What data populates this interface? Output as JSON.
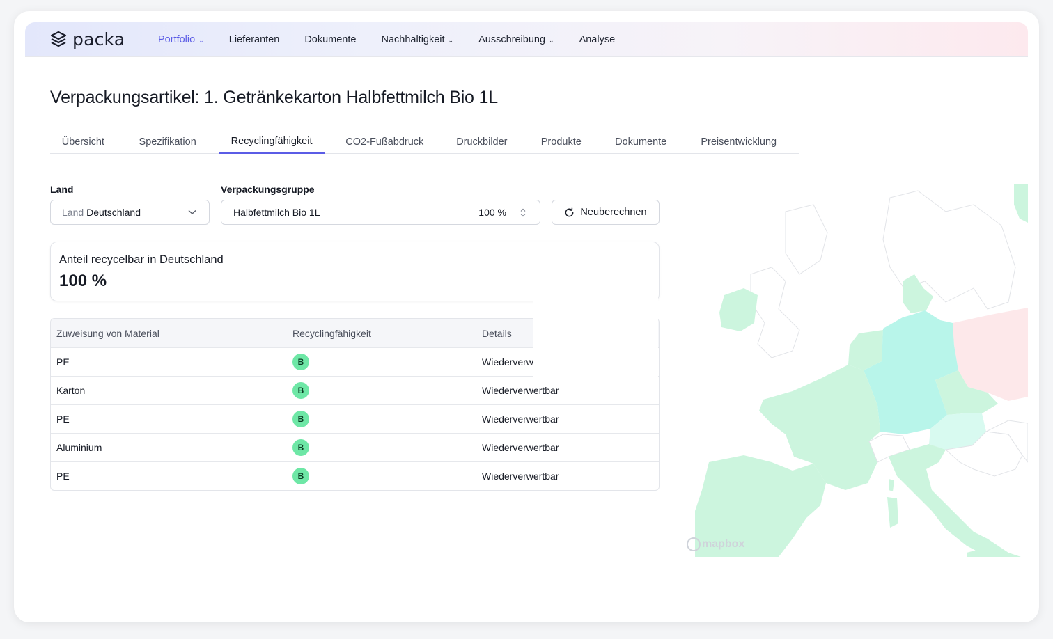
{
  "brand": {
    "name": "packa"
  },
  "nav": {
    "items": [
      {
        "label": "Portfolio",
        "dropdown": true,
        "active": true
      },
      {
        "label": "Lieferanten",
        "dropdown": false
      },
      {
        "label": "Dokumente",
        "dropdown": false
      },
      {
        "label": "Nachhaltigkeit",
        "dropdown": true
      },
      {
        "label": "Ausschreibung",
        "dropdown": true
      },
      {
        "label": "Analyse",
        "dropdown": false
      }
    ]
  },
  "page": {
    "title": "Verpackungsartikel: 1. Getränkekarton Halbfettmilch Bio 1L"
  },
  "tabs": [
    {
      "label": "Übersicht"
    },
    {
      "label": "Spezifikation"
    },
    {
      "label": "Recyclingfähigkeit",
      "active": true
    },
    {
      "label": "CO2-Fußabdruck"
    },
    {
      "label": "Druckbilder"
    },
    {
      "label": "Produkte"
    },
    {
      "label": "Dokumente"
    },
    {
      "label": "Preisentwicklung"
    }
  ],
  "filters": {
    "country_label": "Land",
    "country_prefix": "Land",
    "country_value": "Deutschland",
    "group_label": "Verpackungsgruppe",
    "group_value": "Halbfettmilch Bio 1L",
    "group_percent": "100 %",
    "recalc_label": "Neuberechnen"
  },
  "summary": {
    "label": "Anteil recycelbar in Deutschland",
    "value": "100 %",
    "value_fraction": 1.0
  },
  "table": {
    "headers": [
      "Zuweisung von Material",
      "Recyclingfähigkeit",
      "Details"
    ],
    "rows": [
      {
        "material": "PE",
        "grade": "B",
        "details": "Wiederverwertbar",
        "details_visible": "Wiederverw"
      },
      {
        "material": "Karton",
        "grade": "B",
        "details": "Wiederverwertbar"
      },
      {
        "material": "PE",
        "grade": "B",
        "details": "Wiederverwertbar"
      },
      {
        "material": "Aluminium",
        "grade": "B",
        "details": "Wiederverwertbar"
      },
      {
        "material": "PE",
        "grade": "B",
        "details": "Wiederverwertbar"
      }
    ]
  },
  "map": {
    "attribution": "mapbox",
    "colors": {
      "green": "#ccf5de",
      "germany": "#b8f5ea",
      "poland": "#fde8ea",
      "austria": "#d8faf0",
      "border": "#e2e4e8"
    }
  },
  "colors": {
    "accent": "#5b5ce6",
    "badge": "#6ee7a6"
  }
}
